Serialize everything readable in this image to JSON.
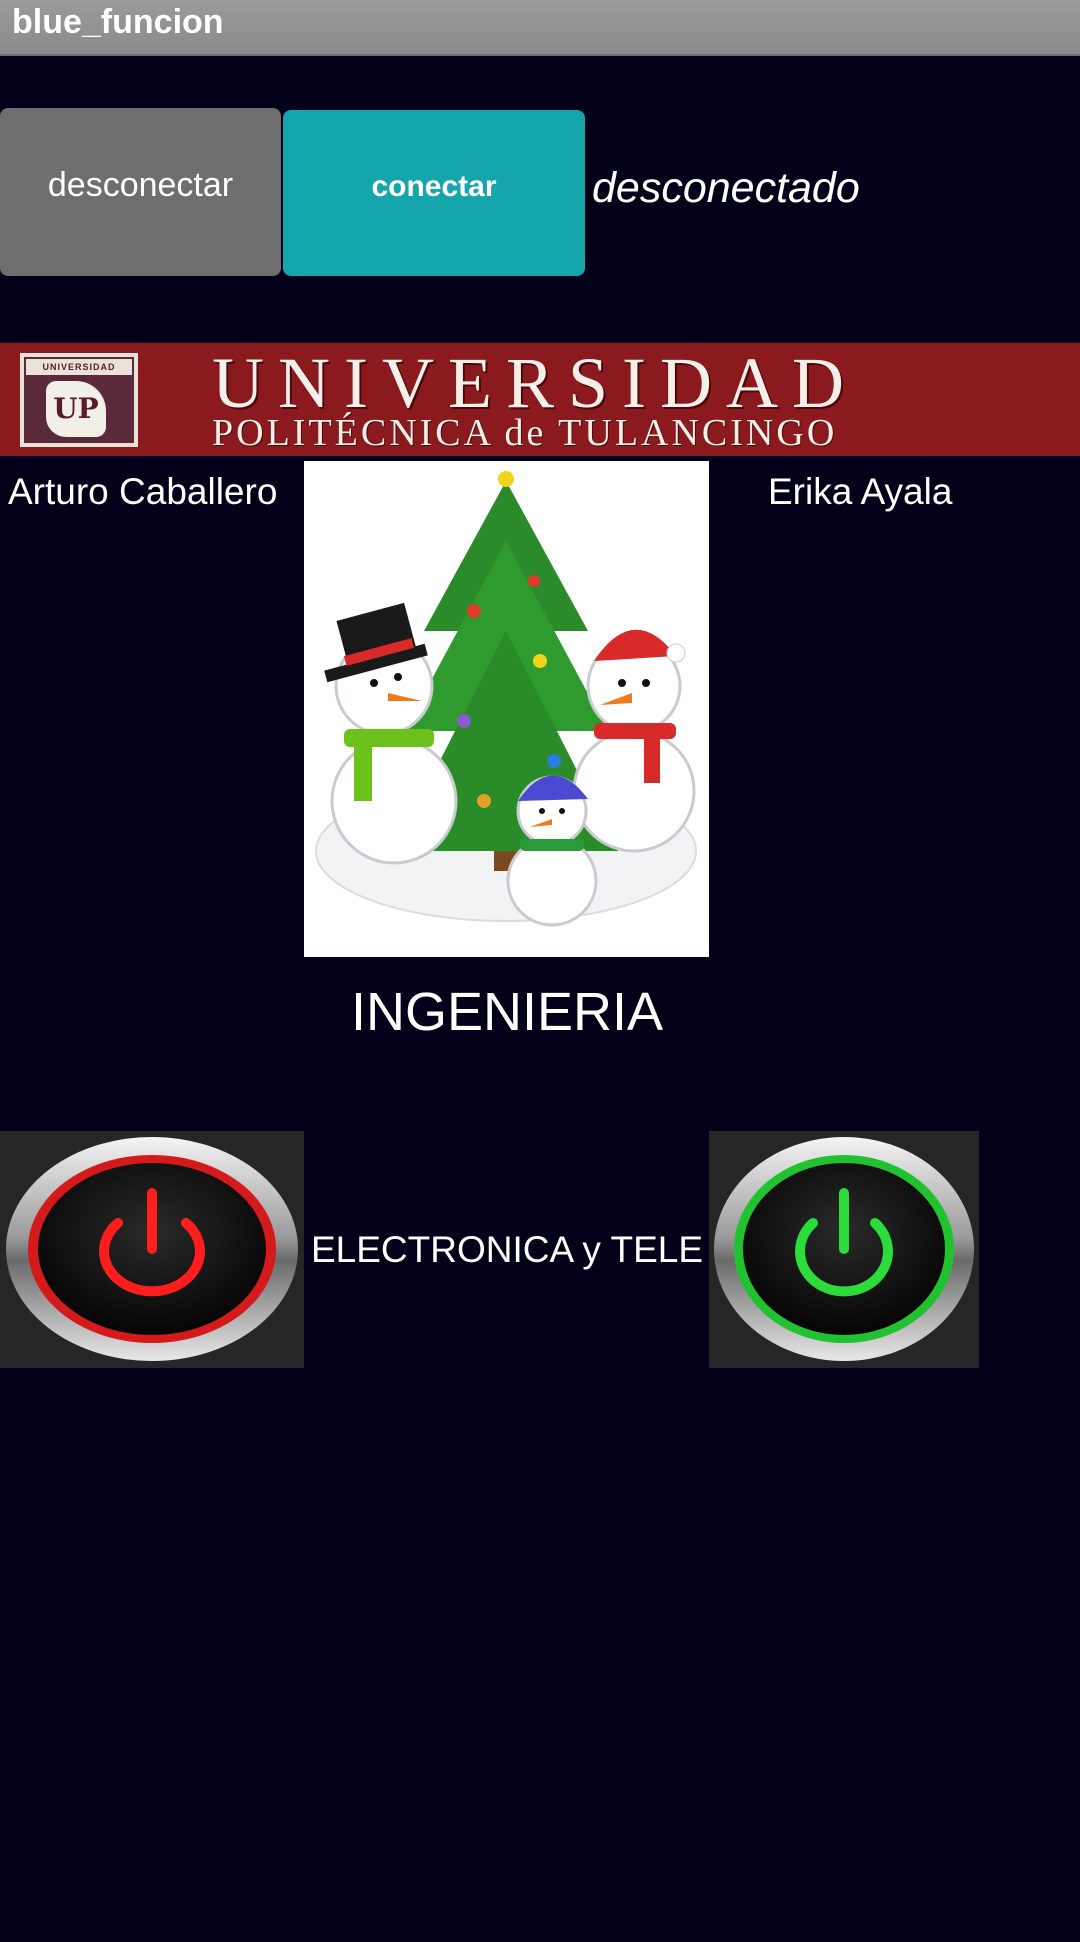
{
  "app": {
    "title": "blue_funcion"
  },
  "controls": {
    "disconnect_label": "desconectar",
    "connect_label": "conectar",
    "status_text": "desconectado"
  },
  "banner": {
    "line1": "UNIVERSIDAD",
    "line2": "POLITÉCNICA de TULANCINGO",
    "logo_text": "UNIVERSIDAD",
    "logo_letter": "UP"
  },
  "people": {
    "left": "Arturo Caballero",
    "right": "Erika Ayala"
  },
  "image": {
    "icon": "christmas-snowmen-tree"
  },
  "labels": {
    "ingenieria": "INGENIERIA",
    "electronica": "ELECTRONICA y TELE"
  },
  "power_buttons": {
    "left_icon": "power-off-icon",
    "right_icon": "power-on-icon"
  },
  "colors": {
    "background": "#03011a",
    "connect_button": "#15a5ad",
    "disconnect_button": "#6e6e6e",
    "banner": "#8a1a1d",
    "power_off": "#e01010",
    "power_on": "#22d032"
  }
}
